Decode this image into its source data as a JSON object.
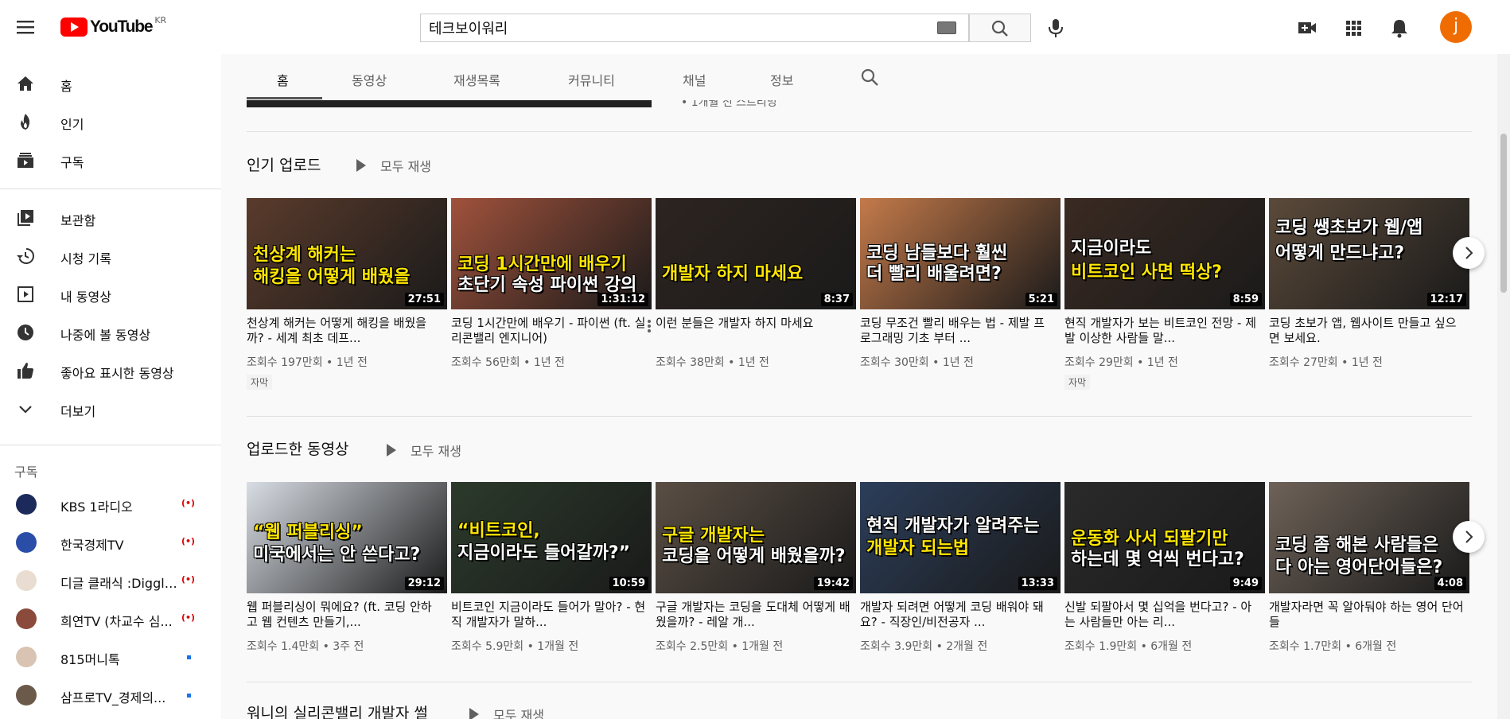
{
  "header": {
    "logo_text": "YouTube",
    "country": "KR",
    "search_value": "테크보이워리",
    "avatar_letter": "j"
  },
  "sidebar": {
    "main": [
      {
        "label": "홈",
        "icon": "home-icon"
      },
      {
        "label": "인기",
        "icon": "fire-icon"
      },
      {
        "label": "구독",
        "icon": "subscriptions-icon"
      }
    ],
    "library": [
      {
        "label": "보관함",
        "icon": "library-icon"
      },
      {
        "label": "시청 기록",
        "icon": "history-icon"
      },
      {
        "label": "내 동영상",
        "icon": "my-videos-icon"
      },
      {
        "label": "나중에 볼 동영상",
        "icon": "clock-icon"
      },
      {
        "label": "좋아요 표시한 동영상",
        "icon": "thumbs-up-icon"
      },
      {
        "label": "더보기",
        "icon": "chevron-down-icon"
      }
    ],
    "subs_heading": "구독",
    "subscriptions": [
      {
        "label": "KBS 1라디오",
        "status": "live"
      },
      {
        "label": "한국경제TV",
        "status": "live"
      },
      {
        "label": "디글 클래식 :Diggle...",
        "status": "live"
      },
      {
        "label": "희연TV (차교수 심...",
        "status": "live"
      },
      {
        "label": "815머니톡",
        "status": "new"
      },
      {
        "label": "삼프로TV_경제의...",
        "status": "new"
      }
    ],
    "live_glyph": "(•)"
  },
  "tabs": [
    "홈",
    "동영상",
    "재생목록",
    "커뮤니티",
    "채널",
    "정보"
  ],
  "content": {
    "prev_text": "• 1개월 전 스트리밍",
    "play_all_label": "모두 재생",
    "shelves": [
      {
        "title": "인기 업로드",
        "videos": [
          {
            "caption": "천상계 해커는",
            "caption2": "해킹을 어떻게 배웠을",
            "duration": "27:51",
            "title": "천상계 해커는 어떻게 해킹을 배웠을까? - 세계 최초 데프...",
            "meta": "조회수 197만회 • 1년 전",
            "badge": "자막"
          },
          {
            "caption": "코딩 1시간만에 배우기",
            "caption2": "초단기 속성 파이썬 강의",
            "duration": "1:31:12",
            "title": "코딩 1시간만에 배우기 - 파이썬 (ft. 실리콘밸리 엔지니어)",
            "meta": "조회수 56만회 • 1년 전",
            "badge": ""
          },
          {
            "caption": "개발자 하지 마세요",
            "caption2": "",
            "duration": "8:37",
            "title": "이런 분들은 개발자 하지 마세요",
            "meta": "조회수 38만회 • 1년 전",
            "badge": ""
          },
          {
            "caption": "코딩 남들보다 훨씬",
            "caption2": "더 빨리 배울려면?",
            "duration": "5:21",
            "title": "코딩 무조건 빨리 배우는 법 - 제발 프로그래밍 기초 부터 ...",
            "meta": "조회수 30만회 • 1년 전",
            "badge": ""
          },
          {
            "caption": "지금이라도",
            "caption2": "비트코인 사면 떡상?",
            "duration": "8:59",
            "title": "현직 개발자가 보는 비트코인 전망 - 제발 이상한 사람들 말...",
            "meta": "조회수 29만회 • 1년 전",
            "badge": "자막"
          },
          {
            "caption": "코딩 쌩초보가 웹/앱",
            "caption2": "어떻게 만드냐고?",
            "duration": "12:17",
            "title": "코딩 초보가 앱, 웹사이트 만들고 싶으면 보세요.",
            "meta": "조회수 27만회 • 1년 전",
            "badge": ""
          }
        ]
      },
      {
        "title": "업로드한 동영상",
        "videos": [
          {
            "caption": "“웹 퍼블리싱”",
            "caption2": "미국에서는 안 쓴다고?",
            "duration": "29:12",
            "title": "웹 퍼블리싱이 뭐에요? (ft. 코딩 안하고 웹 컨텐츠 만들기,...",
            "meta": "조회수 1.4만회 • 3주 전",
            "badge": ""
          },
          {
            "caption": "“비트코인,",
            "caption2": "지금이라도 들어갈까?”",
            "duration": "10:59",
            "title": "비트코인 지금이라도 들어가 말아? - 현직 개발자가 말하...",
            "meta": "조회수 5.9만회 • 1개월 전",
            "badge": ""
          },
          {
            "caption": "구글 개발자는",
            "caption2": "코딩을 어떻게 배웠을까?",
            "duration": "19:42",
            "title": "구글 개발자는 코딩을 도대체 어떻게 배웠을까? - 레알 개...",
            "meta": "조회수 2.5만회 • 1개월 전",
            "badge": ""
          },
          {
            "caption": "현직 개발자가 알려주는",
            "caption2": "개발자 되는법",
            "duration": "13:33",
            "title": "개발자 되려면 어떻게 코딩 배워야 돼요? - 직장인/비전공자 ...",
            "meta": "조회수 3.9만회 • 2개월 전",
            "badge": ""
          },
          {
            "caption": "운동화 사서 되팔기만",
            "caption2": "하는데 몇 억씩 번다고?",
            "duration": "9:49",
            "title": "신발 되팔아서 몇 십억을 번다고? - 아는 사람들만 아는 리...",
            "meta": "조회수 1.9만회 • 6개월 전",
            "badge": ""
          },
          {
            "caption": "코딩 좀 해본 사람들은",
            "caption2": "다 아는 영어단어들은?",
            "duration": "4:08",
            "title": "개발자라면 꼭 알아둬야 하는 영어 단어들",
            "meta": "조회수 1.7만회 • 6개월 전",
            "badge": ""
          }
        ]
      },
      {
        "title": "워니의 실리콘밸리 개발자 썰",
        "videos": []
      }
    ]
  },
  "colors": {
    "accent": "#ff0000",
    "text": "#0f0f0f",
    "muted": "#606060",
    "caption_yellow": "#ffe600"
  }
}
